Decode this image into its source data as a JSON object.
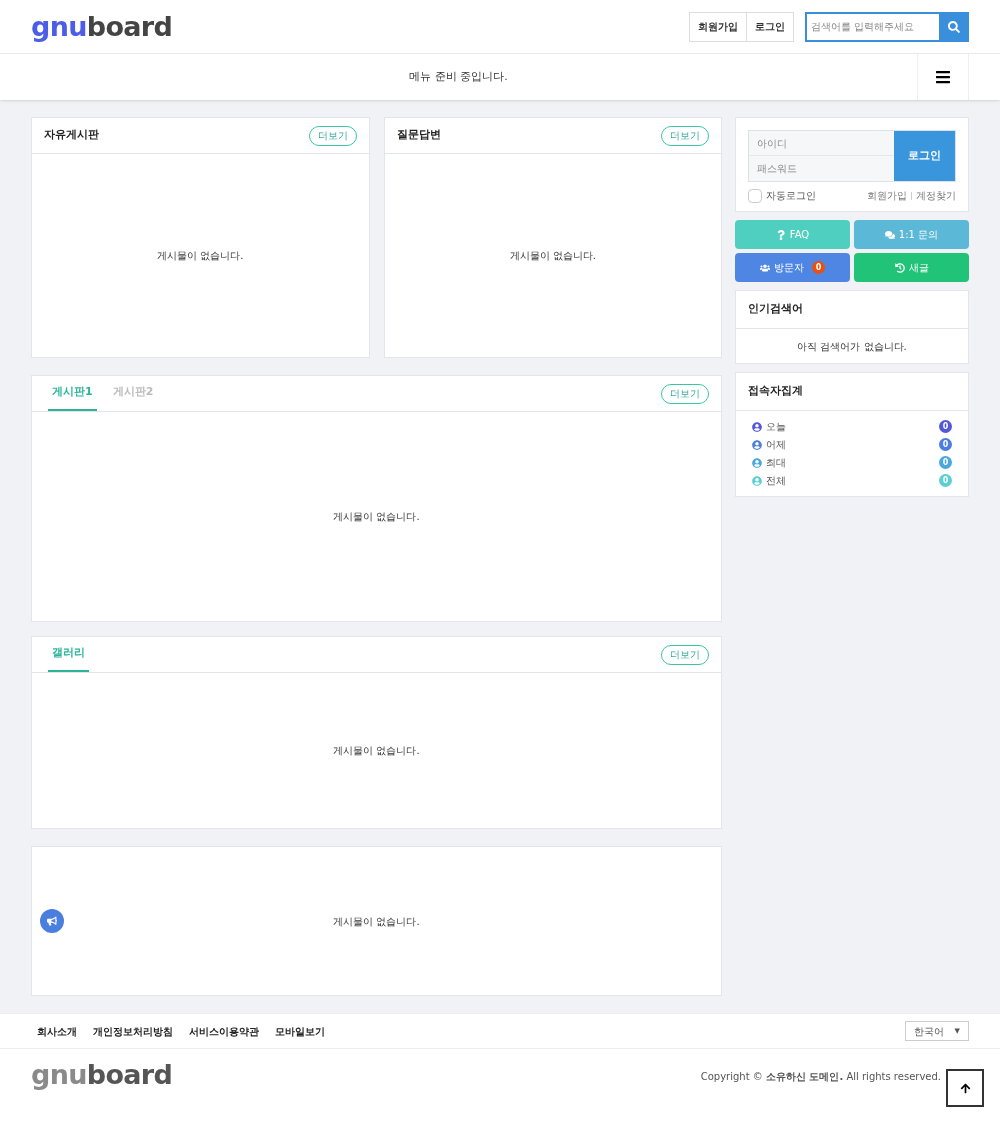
{
  "header": {
    "logo": {
      "part1": "gnu",
      "part2": "board"
    },
    "links": [
      "회원가입",
      "로그인"
    ],
    "search": {
      "placeholder": "검색어를 입력해주세요"
    }
  },
  "nav": {
    "message": "메뉴 준비 중입니다."
  },
  "boards": [
    {
      "title": "자유게시판",
      "more": "더보기",
      "empty": "게시물이 없습니다."
    },
    {
      "title": "질문답변",
      "more": "더보기",
      "empty": "게시물이 없습니다."
    }
  ],
  "tab_board": {
    "tabs": [
      {
        "label": "게시판1",
        "selected": true
      },
      {
        "label": "게시판2",
        "selected": false
      }
    ],
    "more": "더보기",
    "empty": "게시물이 없습니다."
  },
  "gallery": {
    "tabs": [
      {
        "label": "갤러리",
        "selected": true
      }
    ],
    "more": "더보기",
    "empty": "게시물이 없습니다."
  },
  "notice": {
    "empty": "게시물이 없습니다."
  },
  "login": {
    "id_placeholder": "아이디",
    "pw_placeholder": "패스워드",
    "button": "로그인",
    "auto_login": {
      "label": "자동로그인",
      "checked": false
    },
    "links": [
      "회원가입",
      "계정찾기"
    ]
  },
  "quick_buttons": [
    {
      "kind": "faq",
      "label": "FAQ",
      "color": "#4fcfbf"
    },
    {
      "kind": "inquiry",
      "label": "1:1 문의",
      "color": "#5bb8d6"
    },
    {
      "kind": "visitors",
      "label": "방문자",
      "badge": "0",
      "color": "#4f86e4"
    },
    {
      "kind": "new",
      "label": "새글",
      "color": "#20c377"
    }
  ],
  "popular": {
    "title": "인기검색어",
    "empty": "아직 검색어가 없습니다."
  },
  "stats": {
    "title": "접속자집계",
    "rows": [
      {
        "label": "오늘",
        "count": "0",
        "color": "#5457d8"
      },
      {
        "label": "어제",
        "count": "0",
        "color": "#4b7ee0"
      },
      {
        "label": "최대",
        "count": "0",
        "color": "#4aa8dc"
      },
      {
        "label": "전체",
        "count": "0",
        "color": "#5ccfd2"
      }
    ]
  },
  "footer": {
    "links": [
      "회사소개",
      "개인정보처리방침",
      "서비스이용약관",
      "모바일보기"
    ],
    "language": "한국어",
    "language_caret": "▼",
    "logo": {
      "part1": "gnu",
      "part2": "board"
    },
    "copyright": "Copyright © **소유하신 도메인.** All rights reserved."
  }
}
